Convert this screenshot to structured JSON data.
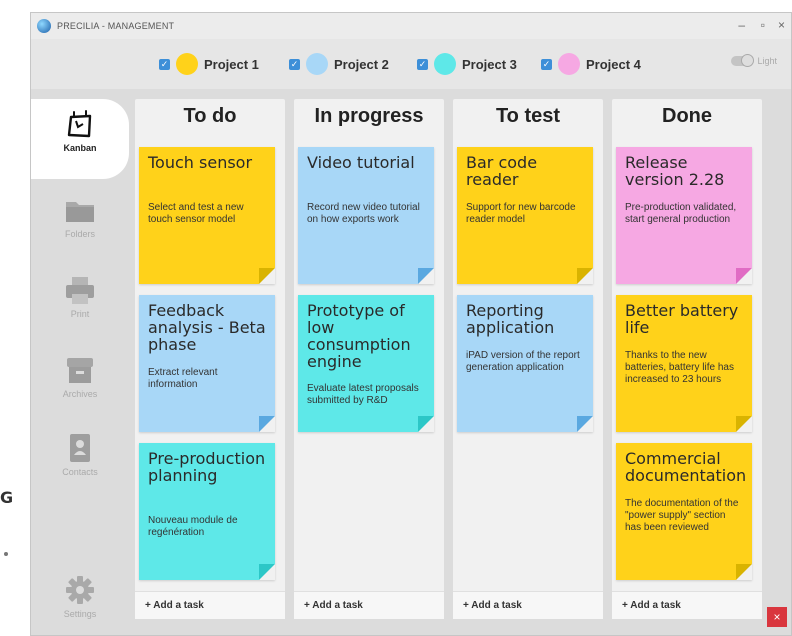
{
  "fragments": {
    "letter": "G"
  },
  "window": {
    "title": "PRECILIA - MANAGEMENT",
    "minimize": "–",
    "maximize": "▫",
    "close": "×"
  },
  "projects": [
    {
      "label": "Project 1",
      "color": "#ffd21a"
    },
    {
      "label": "Project 2",
      "color": "#a8d7f7"
    },
    {
      "label": "Project 3",
      "color": "#5ee8e8"
    },
    {
      "label": "Project 4",
      "color": "#f6a8e3"
    }
  ],
  "theme": {
    "label": "Light"
  },
  "sidebar": {
    "items": [
      {
        "label": "Kanban",
        "icon": "kanban-board-icon",
        "active": true
      },
      {
        "label": "Folders",
        "icon": "folder-icon"
      },
      {
        "label": "Print",
        "icon": "printer-icon"
      },
      {
        "label": "Archives",
        "icon": "archive-box-icon"
      },
      {
        "label": "Contacts",
        "icon": "contact-card-icon"
      },
      {
        "label": "Settings",
        "icon": "gear-icon"
      }
    ]
  },
  "colors": {
    "yellow": "#ffd21a",
    "blue": "#a8d7f7",
    "cyan": "#5ee8e8",
    "pink": "#f6a8e3"
  },
  "columns": [
    {
      "title": "To do",
      "cards": [
        {
          "title": "Touch sensor",
          "desc": "Select and test a new touch sensor model",
          "color": "yellow"
        },
        {
          "title": "Feedback analysis - Beta phase",
          "desc": "Extract relevant information",
          "color": "blue"
        },
        {
          "title": "Pre-production planning",
          "desc": "Nouveau module de regénération",
          "color": "cyan"
        }
      ],
      "add_label": "+ Add a task"
    },
    {
      "title": "In progress",
      "cards": [
        {
          "title": "Video tutorial",
          "desc": "Record new video tutorial on how exports work",
          "color": "blue"
        },
        {
          "title": "Prototype of low consumption engine",
          "desc": "Evaluate latest proposals submitted by R&D",
          "color": "cyan"
        }
      ],
      "add_label": "+ Add a task"
    },
    {
      "title": "To test",
      "cards": [
        {
          "title": "Bar code reader",
          "desc": "Support for new barcode reader model",
          "color": "yellow"
        },
        {
          "title": "Reporting application",
          "desc": "iPAD version of the report generation application",
          "color": "blue"
        }
      ],
      "add_label": "+ Add a task"
    },
    {
      "title": "Done",
      "cards": [
        {
          "title": "Release version 2.28",
          "desc": "Pre-production validated, start general production",
          "color": "pink"
        },
        {
          "title": "Better battery life",
          "desc": "Thanks to the new batteries, battery life has increased to 23 hours",
          "color": "yellow"
        },
        {
          "title": "Commercial documentation",
          "desc": "The documentation of the \"power supply\" section has been reviewed",
          "color": "yellow"
        }
      ],
      "add_label": "+ Add a task"
    }
  ],
  "close_badge": "×"
}
